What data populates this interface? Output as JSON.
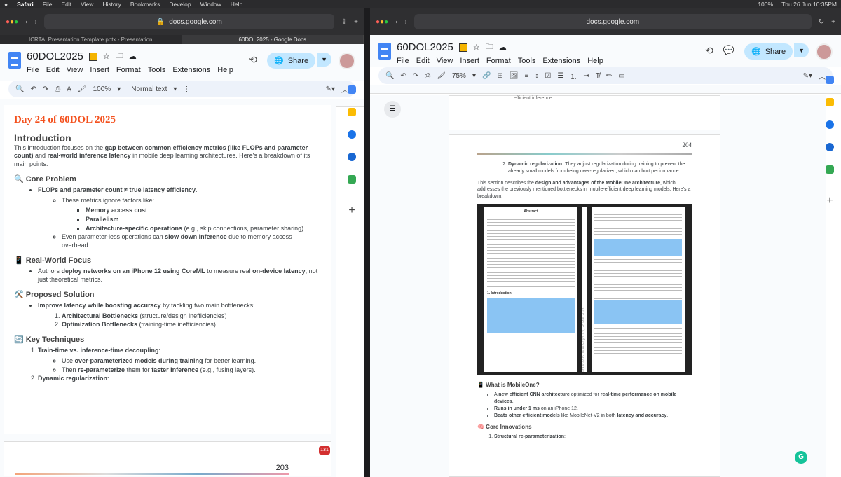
{
  "menubar": {
    "apple": "",
    "items": [
      "Safari",
      "File",
      "Edit",
      "View",
      "History",
      "Bookmarks",
      "Develop",
      "Window",
      "Help"
    ],
    "battery": "100%",
    "clock": "Thu 26 Jun  10:35PM"
  },
  "left": {
    "url": "docs.google.com",
    "tabs": [
      "ICRTAI Presentation Template.pptx - Presentation",
      "60DOL2025 - Google Docs"
    ],
    "doc_title": "60DOL2025",
    "menus": [
      "File",
      "Edit",
      "View",
      "Insert",
      "Format",
      "Tools",
      "Extensions",
      "Help"
    ],
    "share": "Share",
    "zoom": "100%",
    "style": "Normal text",
    "content": {
      "day": "Day 24 of 60DOL 2025",
      "intro_heading": "Introduction",
      "intro_p1": "This introduction focuses on the ",
      "intro_b1": "gap between common efficiency metrics (like FLOPs and parameter count)",
      "intro_p2": " and ",
      "intro_b2": "real-world inference latency",
      "intro_p3": " in mobile deep learning architectures. Here's a breakdown of its main points:",
      "core_problem": "🔍 Core Problem",
      "cp_b1": "FLOPs and parameter count ≠ true latency efficiency",
      "cp_s1": "These metrics ignore factors like:",
      "cp_ss": [
        "Memory access cost",
        "Parallelism",
        "Architecture-specific operations"
      ],
      "cp_ss3_tail": " (e.g., skip connections, parameter sharing)",
      "cp_s2a": "Even parameter-less operations can ",
      "cp_s2b": "slow down inference",
      "cp_s2c": " due to memory access overhead.",
      "rw_heading": "📱 Real-World Focus",
      "rw_a": "Authors ",
      "rw_b": "deploy networks on an iPhone 12 using CoreML",
      "rw_c": " to measure real ",
      "rw_d": "on-device latency",
      "rw_e": ", not just theoretical metrics.",
      "ps_heading": "🛠️ Proposed Solution",
      "ps_b": "Improve latency while boosting accuracy",
      "ps_t": " by tackling two main bottlenecks:",
      "ps_1b": "Architectural Bottlenecks",
      "ps_1t": " (structure/design inefficiencies)",
      "ps_2b": "Optimization Bottlenecks",
      "ps_2t": " (training-time inefficiencies)",
      "kt_heading": "🔄 Key Techniques",
      "kt_1b": "Train-time vs. inference-time decoupling",
      "kt_1t": ":",
      "kt_s1a": "Use ",
      "kt_s1b": "over-parameterized models during training",
      "kt_s1c": " for better learning.",
      "kt_s2a": "Then ",
      "kt_s2b": "re-parameterize",
      "kt_s2c": " them for ",
      "kt_s2d": "faster inference",
      "kt_s2e": " (e.g., fusing layers).",
      "kt_2b": "Dynamic regularization",
      "kt_2t": ":",
      "page_number": "203",
      "notif": "131"
    }
  },
  "right": {
    "url": "docs.google.com",
    "doc_title": "60DOL2025",
    "menus": [
      "File",
      "Edit",
      "View",
      "Insert",
      "Format",
      "Tools",
      "Extensions",
      "Help"
    ],
    "share": "Share",
    "zoom": "75%",
    "prev_tail": "efficient inference.",
    "page_number": "204",
    "dr_b": "Dynamic regularization:",
    "dr_t": " They adjust regularization during training to prevent the already small models from being over-regularized, which can hurt performance.",
    "sec_a": "This section describes the ",
    "sec_b": "design and advantages of the MobileOne architecture",
    "sec_c": ", which addresses the previously mentioned bottlenecks in mobile-efficient deep learning models. Here's a breakdown:",
    "paper_abstract": "Abstract",
    "paper_side": "arXiv:2206.04040v2 [cs.CV] 28 Mar 2023",
    "paper_intro": "1. Introduction",
    "what_heading": "📱 What is MobileOne?",
    "w1a": "A ",
    "w1b": "new efficient CNN architecture",
    "w1c": " optimized for ",
    "w1d": "real-time performance on mobile devices",
    "w1e": ".",
    "w2b": "Runs in under 1 ms",
    "w2t": " on an iPhone 12.",
    "w3b": "Beats other efficient models",
    "w3c": " like MobileNet-V2 in both ",
    "w3d": "latency and accuracy",
    "w3e": ".",
    "ci_heading": "🧠 Core Innovations",
    "ci_1b": "Structural re-parameterization",
    "ci_1t": ":"
  },
  "colors": {
    "share_bg": "#c2e7ff",
    "accent_orange": "#f4511e",
    "docs_blue": "#4285f4"
  }
}
